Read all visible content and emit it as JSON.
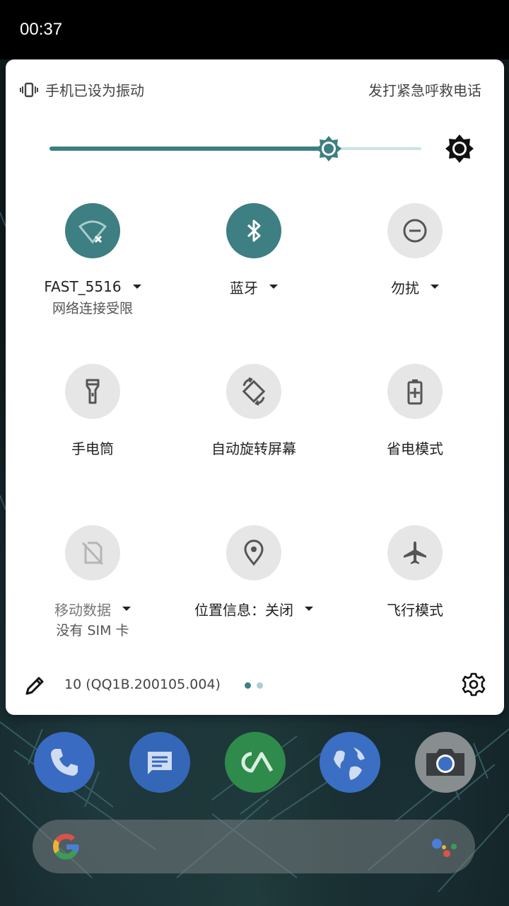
{
  "status_bar": {
    "time": "00:37"
  },
  "panel": {
    "ringer_status": "手机已设为振动",
    "emergency_call": "发打紧急呼救电话",
    "brightness": {
      "level": 0.75
    },
    "tiles": [
      {
        "label": "FAST_5516",
        "sub": "网络连接受限",
        "state": "on",
        "icon": "wifi-limited-icon",
        "dropdown": true
      },
      {
        "label": "蓝牙",
        "sub": "",
        "state": "on",
        "icon": "bluetooth-icon",
        "dropdown": true
      },
      {
        "label": "勿扰",
        "sub": "",
        "state": "off",
        "icon": "do-not-disturb-icon",
        "dropdown": true
      },
      {
        "label": "手电筒",
        "sub": "",
        "state": "off",
        "icon": "flashlight-icon",
        "dropdown": false
      },
      {
        "label": "自动旋转屏幕",
        "sub": "",
        "state": "off",
        "icon": "auto-rotate-icon",
        "dropdown": false
      },
      {
        "label": "省电模式",
        "sub": "",
        "state": "off",
        "icon": "battery-saver-icon",
        "dropdown": false
      },
      {
        "label": "移动数据",
        "sub": "没有 SIM 卡",
        "state": "disabled",
        "icon": "no-sim-icon",
        "dropdown": true
      },
      {
        "label": "位置信息：关闭",
        "sub": "",
        "state": "off",
        "icon": "location-icon",
        "dropdown": true
      },
      {
        "label": "飞行模式",
        "sub": "",
        "state": "off",
        "icon": "airplane-icon",
        "dropdown": false
      }
    ],
    "footer": {
      "build_number": "10 (QQ1B.200105.004)",
      "page_count": 2,
      "current_page": 1
    }
  },
  "dock": {
    "apps": [
      "phone-icon",
      "messages-icon",
      "app-icon",
      "browser-icon",
      "camera-icon"
    ]
  },
  "colors": {
    "accent": "#3d7f82",
    "tile_off": "#e6e6e6",
    "panel_bg": "#ffffff"
  }
}
